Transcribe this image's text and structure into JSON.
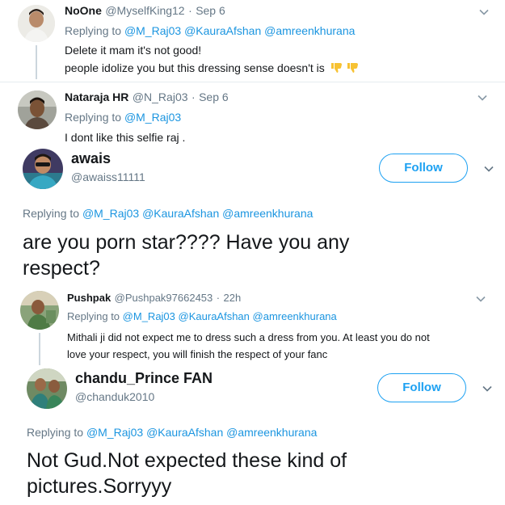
{
  "tweets": [
    {
      "name": "NoOne",
      "handle": "@MyselfKing12",
      "sep": "·",
      "date": "Sep 6",
      "replying_prefix": "Replying to",
      "mentions": [
        "@M_Raj03",
        "@KauraAfshan",
        "@amreenkhurana"
      ],
      "lines": [
        "Delete it mam it's not good!",
        "people idolize you but this dressing sense doesn't is"
      ],
      "emoji": "thumbs-down-icon"
    },
    {
      "name": "Nataraja HR",
      "handle": "@N_Raj03",
      "sep": "·",
      "date": "Sep 6",
      "replying_prefix": "Replying to",
      "mentions": [
        "@M_Raj03"
      ],
      "lines": [
        "I dont like this selfie raj ."
      ]
    },
    {
      "name": "Pushpak",
      "handle": "@Pushpak97662453",
      "sep": "·",
      "date": "22h",
      "replying_prefix": "Replying to",
      "mentions": [
        "@M_Raj03",
        "@KauraAfshan",
        "@amreenkhurana"
      ],
      "lines": [
        "Mithali ji did not expect me to dress such a dress from you. At least you do not",
        "love your respect, you will finish the respect of your fanc"
      ]
    }
  ],
  "focused": [
    {
      "name": "awais",
      "handle": "@awaiss11111",
      "follow_label": "Follow",
      "replying_prefix": "Replying to",
      "mentions": [
        "@M_Raj03",
        "@KauraAfshan",
        "@amreenkhurana"
      ],
      "lines": [
        "are you porn star???? Have you any",
        "respect?"
      ]
    },
    {
      "name": "chandu_Prince FAN",
      "handle": "@chanduk2010",
      "follow_label": "Follow",
      "replying_prefix": "Replying to",
      "mentions": [
        "@M_Raj03",
        "@KauraAfshan",
        "@amreenkhurana"
      ],
      "lines": [
        "Not Gud.Not expected these kind of",
        "pictures.Sorryyy"
      ]
    }
  ],
  "colors": {
    "link": "#1b95e0",
    "follow": "#1da1f2",
    "secondary": "#657786",
    "thread_line": "#ccd6dd"
  }
}
